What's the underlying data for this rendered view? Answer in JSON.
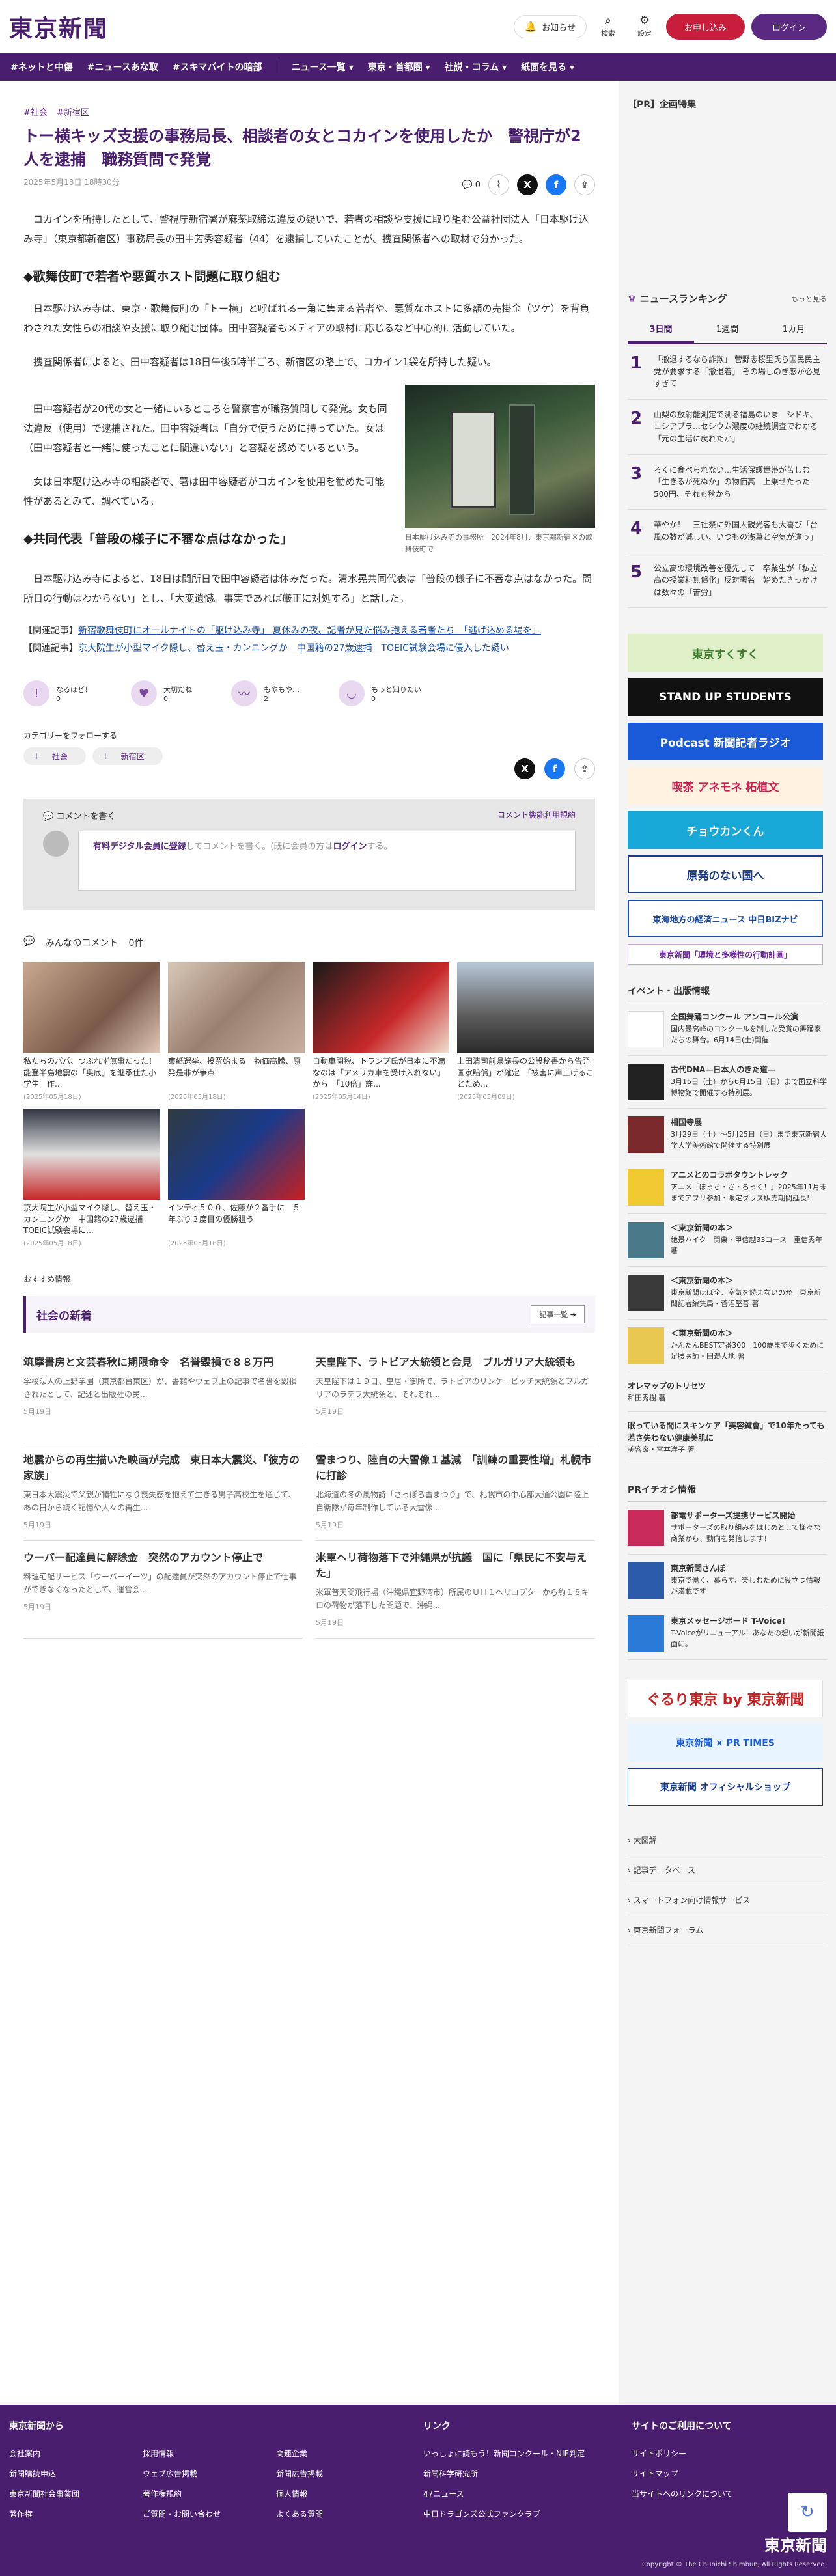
{
  "header": {
    "logo": "東京新聞",
    "notice": "お知らせ",
    "search": "検索",
    "settings": "設定",
    "register": "お申し込み",
    "login": "ログイン"
  },
  "nav": [
    "#ネットと中傷",
    "#ニュースあな取",
    "#スキマバイトの暗部",
    "ニュース一覧",
    "東京・首都圏",
    "社説・コラム",
    "紙面を見る"
  ],
  "article": {
    "tags": [
      "#社会",
      "#新宿区"
    ],
    "headline": "トー横キッズ支援の事務局長、相談者の女とコカインを使用したか　警視庁が2人を逮捕　職務質問で発覚",
    "date": "2025年5月18日 18時30分",
    "comment_count": "0",
    "lead": "コカインを所持したとして、警視庁新宿署が麻薬取締法違反の疑いで、若者の相談や支援に取り組む公益社団法人「日本駆け込み寺」（東京都新宿区）事務局長の田中芳秀容疑者（44）を逮捕していたことが、捜査関係者への取材で分かった。",
    "h2_1": "◆歌舞伎町で若者や悪質ホスト問題に取り組む",
    "p1": "日本駆け込み寺は、東京・歌舞伎町の「トー横」と呼ばれる一角に集まる若者や、悪質なホストに多額の売掛金（ツケ）を背負わされた女性らの相談や支援に取り組む団体。田中容疑者もメディアの取材に応じるなど中心的に活動していた。",
    "p2": "捜査関係者によると、田中容疑者は18日午後5時半ごろ、新宿区の路上で、コカイン1袋を所持した疑い。",
    "p3": "田中容疑者が20代の女と一緒にいるところを警察官が職務質問して発覚。女も同法違反（使用）で逮捕された。田中容疑者は「自分で使うために持っていた。女は（田中容疑者と一緒に使ったことに間違いない」と容疑を認めているという。",
    "p4": "女は日本駆け込み寺の相談者で、署は田中容疑者がコカインを使用を勧めた可能性があるとみて、調べている。",
    "fig_caption": "日本駆け込み寺の事務所＝2024年8月、東京都新宿区の歌舞伎町で",
    "h2_2": "◆共同代表「普段の様子に不審な点はなかった」",
    "p5": "日本駆け込み寺によると、18日は問所日で田中容疑者は休みだった。清水晃共同代表は「普段の様子に不審な点はなかった。問所日の行動はわからない」とし、「大変遺憾。事実であれば厳正に対処する」と話した。",
    "related_label": "【関連記事】",
    "related": [
      "新宿歌舞伎町にオールナイトの「駆け込み寺」 夏休みの夜、記者が見た悩み抱える若者たち　「逃げ込める場を」",
      "京大院生が小型マイク隠し、替え玉・カンニングか　中国籍の27歳逮捕　TOEIC試験会場に侵入した疑い"
    ]
  },
  "reactions": [
    {
      "label": "なるほど！",
      "count": "0"
    },
    {
      "label": "大切だね",
      "count": "0"
    },
    {
      "label": "もやもや…",
      "count": "2"
    },
    {
      "label": "もっと知りたい",
      "count": "0"
    }
  ],
  "follow": {
    "label": "カテゴリーをフォローする",
    "tags": [
      "社会",
      "新宿区"
    ]
  },
  "comment_box": {
    "title": "コメントを書く",
    "rules": "コメント機能利用規約",
    "prompt_pre": "有料デジタル会員に登録",
    "prompt_mid": "してコメントを書く。(既に会員の方は",
    "prompt_login": "ログイン",
    "prompt_post": "する。"
  },
  "all_comments": {
    "label": "みんなのコメント",
    "count": "0件"
  },
  "thumbs": [
    {
      "title": "私たちのパパ、つぶれず無事だった！　能登半島地震の「奥底」を継承仕た小学生　作...",
      "date": "(2025年05月18日)"
    },
    {
      "title": "東紙選挙、投票始まる　物価高騰、原発是非が争点",
      "date": "(2025年05月18日)"
    },
    {
      "title": "自動車関税、トランプ氏が日本に不満なのは「アメリカ車を受け入れない」から　「10倍」詳...",
      "date": "(2025年05月14日)"
    },
    {
      "title": "上田清司前県議長の公設秘書から告発　国家賠償」が確定　「被害に声上げることため...",
      "date": "(2025年05月09日)"
    },
    {
      "title": "京大院生が小型マイク隠し、替え玉・カンニングか　中国籍の27歳逮捕　TOEIC試験会場に...",
      "date": "(2025年05月18日)"
    },
    {
      "title": "インディ５００、佐藤が２番手に　５年ぶり３度目の優勝狙う",
      "date": "(2025年05月18日)"
    }
  ],
  "recommended_label": "おすすめ情報",
  "latest": {
    "title": "社会の新着",
    "more": "記事一覧",
    "items": [
      {
        "h": "筑摩書房と文芸春秋に期限命令　名誉毀損で８８万円",
        "p": "学校法人の上野学園（東京都台東区）が、書籍やウェブ上の記事で名誉を毀損されたとして、記述と出版社の民...",
        "d": "5月19日"
      },
      {
        "h": "天皇陛下、ラトビア大統領と会見　ブルガリア大統領も",
        "p": "天皇陛下は１９日、皇居・御所で、ラトビアのリンケービッチ大統領とブルガリアのラデフ大統領と、それぞれ...",
        "d": "5月19日"
      },
      {
        "h": "地震からの再生描いた映画が完成　東日本大震災、「彼方の家族」",
        "p": "東日本大震災で父親が犠牲になり喪失感を抱えて生きる男子高校生を通じて、あの日から続く記憶や人々の再生...",
        "d": "5月19日"
      },
      {
        "h": "雪まつり、陸自の大雪像１基減　「訓練の重要性増」札幌市に打診",
        "p": "北海道の冬の風物詩「さっぽろ雪まつり」で、札幌市の中心部大通公園に陸上自衛隊が毎年制作している大雪像...",
        "d": "5月19日"
      },
      {
        "h": "ウーバー配達員に解除金　突然のアカウント停止で",
        "p": "料理宅配サービス「ウーバーイーツ」の配達員が突然のアカウント停止で仕事ができなくなったとして、運営会...",
        "d": "5月19日"
      },
      {
        "h": "米軍ヘリ荷物落下で沖縄県が抗議　国に「県民に不安与えた」",
        "p": "米軍普天間飛行場（沖縄県宜野湾市）所属のＵＨ１ヘリコプターから約１８キロの荷物が落下した問題で、沖縄...",
        "d": "5月19日"
      }
    ]
  },
  "sidebar": {
    "pr_title": "【PR】企画特集",
    "ranking_title": "ニュースランキング",
    "ranking_more": "もっと見る",
    "tabs": [
      "3日間",
      "1週間",
      "1カ月"
    ],
    "ranking": [
      "「撤退するなら詐欺」 菅野志桜里氏ら国民民主党が要求する「撤退着」 その場しのぎ感が必見すぎて",
      "山梨の放射能測定で測る福島のいま　シドキ、コシアブラ…セシウム濃度の継続調査でわかる「元の生活に戻れたか」",
      "ろくに食べられない…生活保護世帯が苦しむ「生きるが死ぬか」の物価高　上乗せたった500円、それも秋から",
      "華やか！　三社祭に外国人観光客も大喜び「台風の数が減しい、いつもの浅草と空気が違う」",
      "公立高の環境改善を優先して　卒業生が「私立高の授業料無償化」反対署名　始めたきっかけは数々の「苦労」"
    ],
    "banners": [
      "東京すくすく",
      "STAND UP STUDENTS",
      "Podcast 新聞記者ラジオ",
      "喫茶 アネモネ 柘植文",
      "チョウカンくん",
      "原発のない国へ",
      "東海地方の経済ニュース 中日BIZナビ",
      "東京新聞「環境と多様性の行動計画」"
    ],
    "events_title": "イベント・出版情報",
    "events": [
      {
        "t": "全国舞踊コンクール アンコール公演",
        "d": "国内最高峰のコンクールを制した受賞の舞踊家たちの舞台。6月14日(土)開催"
      },
      {
        "t": "古代DNA—日本人のきた道—",
        "d": "3月15日（土）から6月15日（日）まで国立科学博物館で開催する特別展。"
      },
      {
        "t": "相国寺展",
        "d": "3月29日（土）～5月25日（日）まで東京新宿大学大学美術館で開催する特別展"
      },
      {
        "t": "アニメとのコラボタウントレック",
        "d": "アニメ「ぼっち・ざ・ろっく！」2025年11月末までアプリ参加・限定グッズ販売期間延長!!"
      },
      {
        "t": "＜東京新聞の本＞",
        "d": "絶景ハイク　関東・甲信越33コース　重信秀年 著"
      },
      {
        "t": "＜東京新聞の本＞",
        "d": "東京新聞ほぼ全、空気を読まないのか　東京新聞記者編集局・菅沼堅吾 著"
      },
      {
        "t": "＜東京新聞の本＞",
        "d": "かんたんBEST定番300　100歳まで歩くために　足腰医師・田邉大地 著"
      },
      {
        "t": "オレマップのトリセツ",
        "d": "和田秀樹 著"
      },
      {
        "t": "眠っている間にスキンケア「美容鍼會」で10年たっても若さ失わない健康美肌に",
        "d": "美容家・宮本洋子 著"
      }
    ],
    "pr_info_title": "PRイチオシ情報",
    "pr_info": [
      {
        "t": "都電サポーターズ提携サービス開始",
        "d": "サポーターズの取り組みをはじめとして様々な商業から、動向を発信します！"
      },
      {
        "t": "東京新聞さんぽ",
        "d": "東京で働く、暮らす、楽しむために役立つ情報が満載です"
      },
      {
        "t": "東京メッセージボード T-Voice!",
        "d": "T-Voiceがリニューアル！あなたの想いが新聞紙面に。"
      }
    ],
    "bottom_banners": [
      "ぐるり東京 by 東京新聞",
      "東京新聞 × PR TIMES",
      "東京新聞 オフィシャルショップ"
    ],
    "links": [
      "大図解",
      "記事データベース",
      "スマートフォン向け情報サービス",
      "東京新聞フォーラム"
    ]
  },
  "footer": {
    "col1": {
      "title": "東京新聞から",
      "links": [
        "会社案内",
        "採用情報",
        "関連企業",
        "新聞購読申込",
        "ウェブ広告掲載",
        "新聞広告掲載",
        "東京新聞社会事業団",
        "著作権規約",
        "個人情報",
        "著作権",
        "ご質問・お問い合わせ",
        "よくある質問"
      ]
    },
    "col2": {
      "title": "リンク",
      "links": [
        "いっしょに読もう！新聞コンクール・NIE判定",
        "新聞科学研究所",
        "47ニュース",
        "中日ドラゴンズ公式ファンクラブ"
      ]
    },
    "col3": {
      "title": "サイトのご利用について",
      "links": [
        "サイトポリシー",
        "サイトマップ",
        "当サイトへのリンクについて"
      ]
    },
    "logo": "東京新聞",
    "copyright": "Copyright © The Chunichi Shimbun, All Rights Reserved."
  }
}
